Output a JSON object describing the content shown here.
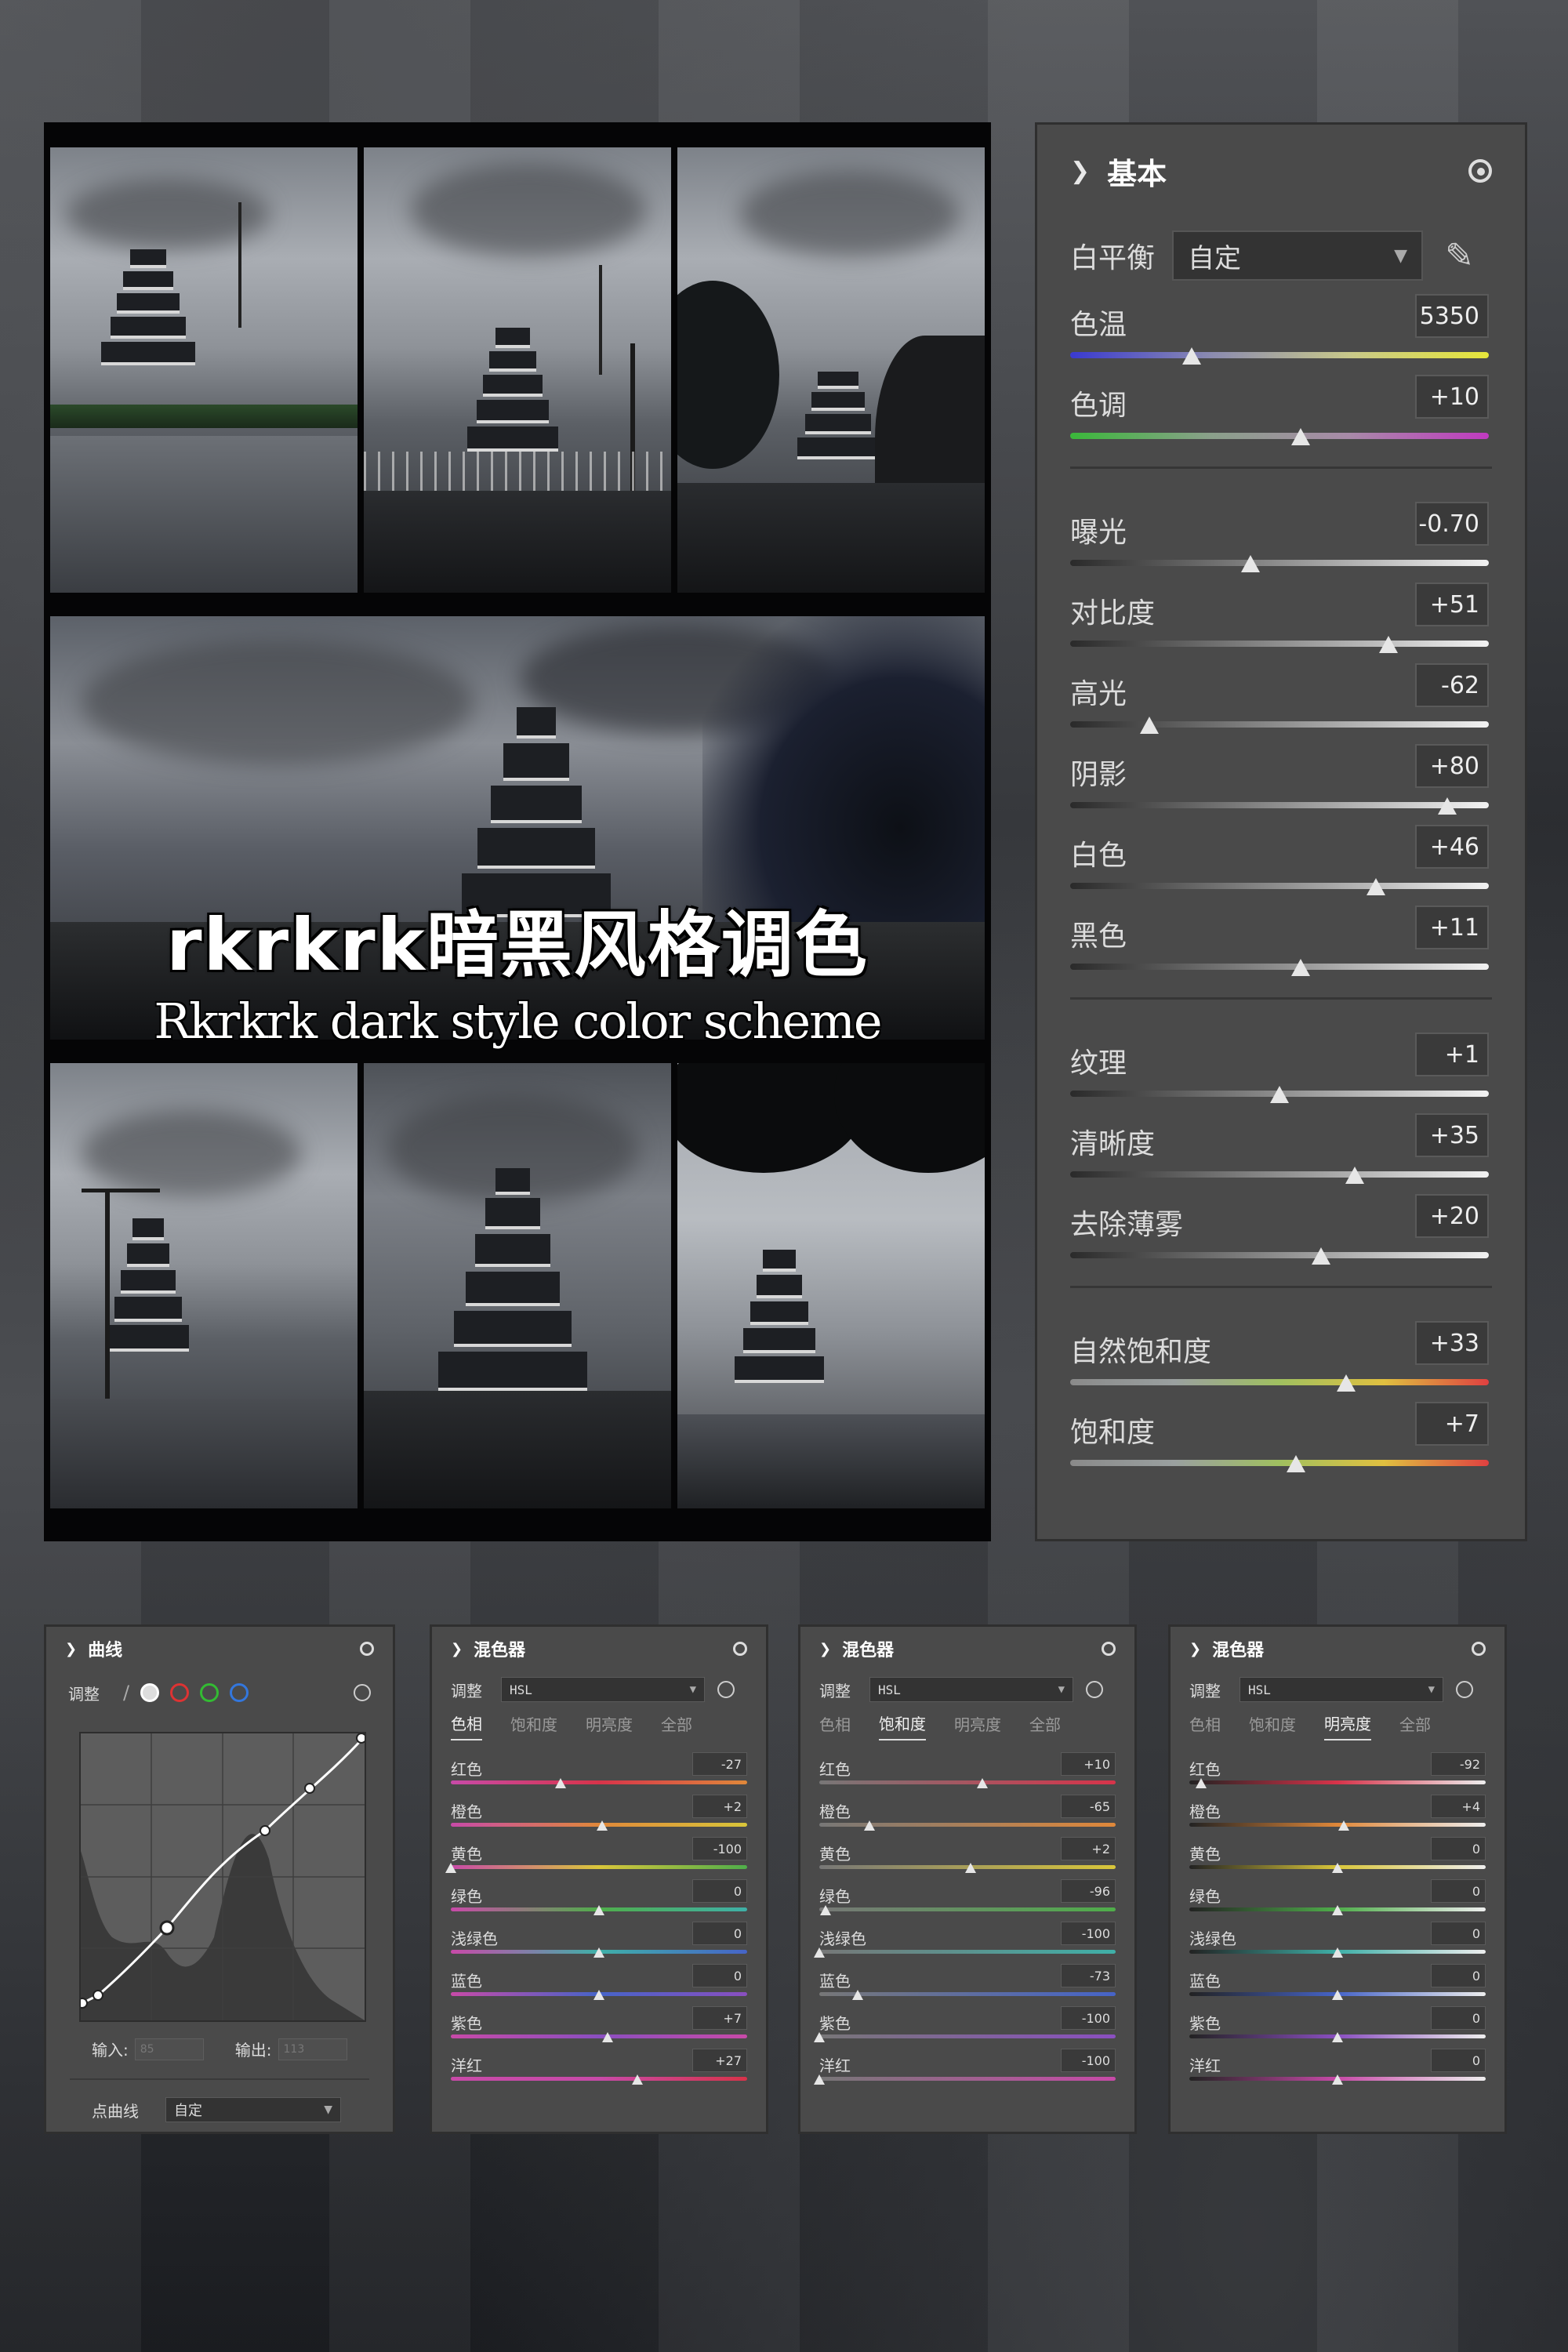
{
  "collage": {
    "title_zh": "rkrkrk暗黑风格调色",
    "title_en": "Rkrkrk dark style color scheme"
  },
  "basic_panel": {
    "title": "基本",
    "white_balance_label": "白平衡",
    "white_balance_value": "自定",
    "sliders": [
      {
        "label": "色温",
        "value": "5350",
        "pos": 0.29,
        "track": "temp"
      },
      {
        "label": "色调",
        "value": "+10",
        "pos": 0.55,
        "track": "tint"
      },
      {
        "label": "曝光",
        "value": "-0.70",
        "pos": 0.43,
        "track": "gray"
      },
      {
        "label": "对比度",
        "value": "+51",
        "pos": 0.76,
        "track": "gray"
      },
      {
        "label": "高光",
        "value": "-62",
        "pos": 0.19,
        "track": "gray"
      },
      {
        "label": "阴影",
        "value": "+80",
        "pos": 0.9,
        "track": "gray"
      },
      {
        "label": "白色",
        "value": "+46",
        "pos": 0.73,
        "track": "gray"
      },
      {
        "label": "黑色",
        "value": "+11",
        "pos": 0.55,
        "track": "gray"
      },
      {
        "label": "纹理",
        "value": "+1",
        "pos": 0.5,
        "track": "gray"
      },
      {
        "label": "清晰度",
        "value": "+35",
        "pos": 0.68,
        "track": "gray"
      },
      {
        "label": "去除薄雾",
        "value": "+20",
        "pos": 0.6,
        "track": "gray"
      },
      {
        "label": "自然饱和度",
        "value": "+33",
        "pos": 0.66,
        "track": "sat"
      },
      {
        "label": "饱和度",
        "value": "+7",
        "pos": 0.54,
        "track": "sat"
      }
    ]
  },
  "curve_panel": {
    "title": "曲线",
    "adjust_label": "调整",
    "input_label": "输入:",
    "input_value": "85",
    "output_label": "输出:",
    "output_value": "113",
    "point_curve_label": "点曲线",
    "point_curve_value": "自定"
  },
  "mixers": [
    {
      "title": "混色器",
      "adjust_label": "调整",
      "mode": "HSL",
      "tabs": [
        "色相",
        "饱和度",
        "明亮度",
        "全部"
      ],
      "active_tab": 0,
      "rows": [
        {
          "label": "红色",
          "value": "-27",
          "pos": 0.37
        },
        {
          "label": "橙色",
          "value": "+2",
          "pos": 0.51
        },
        {
          "label": "黄色",
          "value": "-100",
          "pos": 0.0
        },
        {
          "label": "绿色",
          "value": "0",
          "pos": 0.5
        },
        {
          "label": "浅绿色",
          "value": "0",
          "pos": 0.5
        },
        {
          "label": "蓝色",
          "value": "0",
          "pos": 0.5
        },
        {
          "label": "紫色",
          "value": "+7",
          "pos": 0.53
        },
        {
          "label": "洋红",
          "value": "+27",
          "pos": 0.63
        }
      ]
    },
    {
      "title": "混色器",
      "adjust_label": "调整",
      "mode": "HSL",
      "tabs": [
        "色相",
        "饱和度",
        "明亮度",
        "全部"
      ],
      "active_tab": 1,
      "rows": [
        {
          "label": "红色",
          "value": "+10",
          "pos": 0.55
        },
        {
          "label": "橙色",
          "value": "-65",
          "pos": 0.17
        },
        {
          "label": "黄色",
          "value": "+2",
          "pos": 0.51
        },
        {
          "label": "绿色",
          "value": "-96",
          "pos": 0.02
        },
        {
          "label": "浅绿色",
          "value": "-100",
          "pos": 0.0
        },
        {
          "label": "蓝色",
          "value": "-73",
          "pos": 0.13
        },
        {
          "label": "紫色",
          "value": "-100",
          "pos": 0.0
        },
        {
          "label": "洋红",
          "value": "-100",
          "pos": 0.0
        }
      ]
    },
    {
      "title": "混色器",
      "adjust_label": "调整",
      "mode": "HSL",
      "tabs": [
        "色相",
        "饱和度",
        "明亮度",
        "全部"
      ],
      "active_tab": 2,
      "rows": [
        {
          "label": "红色",
          "value": "-92",
          "pos": 0.04
        },
        {
          "label": "橙色",
          "value": "+4",
          "pos": 0.52
        },
        {
          "label": "黄色",
          "value": "0",
          "pos": 0.5
        },
        {
          "label": "绿色",
          "value": "0",
          "pos": 0.5
        },
        {
          "label": "浅绿色",
          "value": "0",
          "pos": 0.5
        },
        {
          "label": "蓝色",
          "value": "0",
          "pos": 0.5
        },
        {
          "label": "紫色",
          "value": "0",
          "pos": 0.5
        },
        {
          "label": "洋红",
          "value": "0",
          "pos": 0.5
        }
      ]
    }
  ],
  "colors": {
    "panel": "#4a4a4a",
    "red": "#d8334a",
    "orange": "#e0883a",
    "yellow": "#d9c63a",
    "green": "#4fae4a",
    "aqua": "#3fb0a8",
    "blue": "#4664c8",
    "purple": "#8a4fc0",
    "magenta": "#c84aa8"
  }
}
